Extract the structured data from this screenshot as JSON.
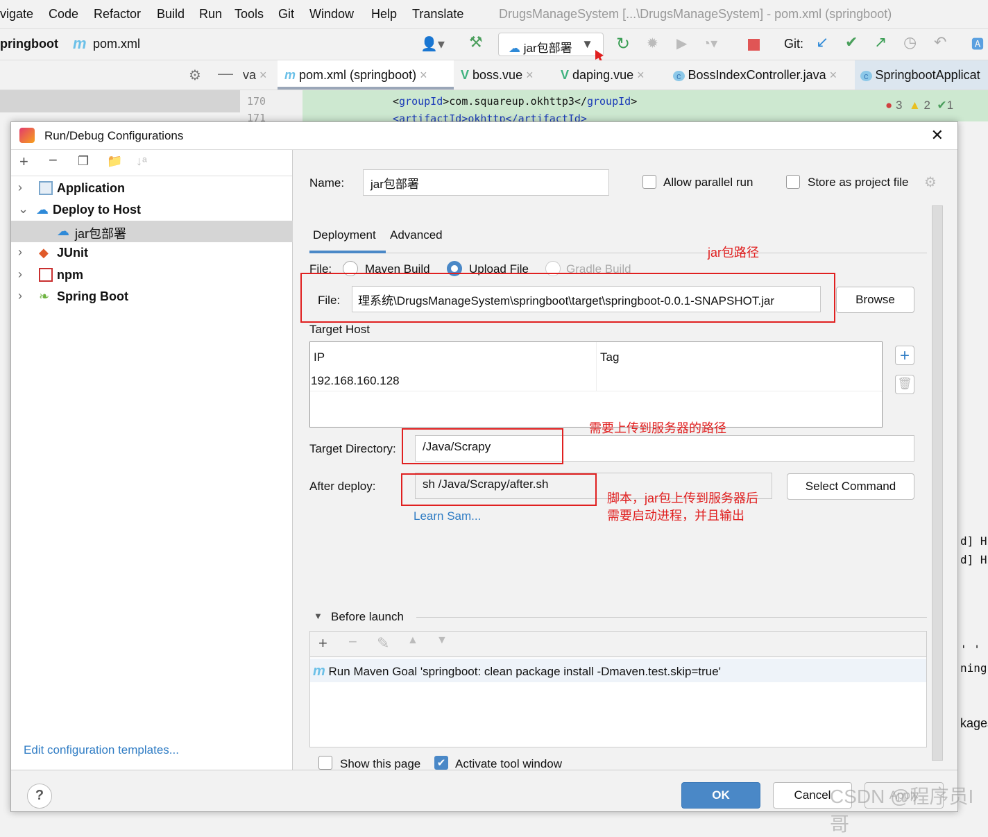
{
  "menu": [
    "vigate",
    "Code",
    "Refactor",
    "Build",
    "Run",
    "Tools",
    "Git",
    "Window",
    "Help",
    "Translate"
  ],
  "window_title": "DrugsManageSystem [...\\DrugsManageSystem] - pom.xml (springboot)",
  "breadcrumb": {
    "project": "pringboot",
    "file": "pom.xml"
  },
  "run_config": "jar包部署",
  "git_label": "Git:",
  "tabs": [
    "va",
    "pom.xml (springboot)",
    "boss.vue",
    "daping.vue",
    "BossIndexController.java",
    "SpringbootApplicat"
  ],
  "editor": {
    "line1": "170",
    "line2": "171",
    "code1_open": "<",
    "code1_tag": "groupId",
    "code1_mid": ">com.squareup.okhttp3</",
    "code1_close": ">",
    "code2": "<artifactId>okhttp</artifactId>",
    "errors": "3",
    "warnings": "2",
    "ok": "1"
  },
  "dialog": {
    "title": "Run/Debug Configurations",
    "tree": [
      {
        "label": "Application",
        "chev": "›"
      },
      {
        "label": "Deploy to Host",
        "chev": "⌄"
      },
      {
        "label": "jar包部署",
        "chev": ""
      },
      {
        "label": "JUnit",
        "chev": "›"
      },
      {
        "label": "npm",
        "chev": "›"
      },
      {
        "label": "Spring Boot",
        "chev": "›"
      }
    ],
    "edit_templates": "Edit configuration templates...",
    "name_label": "Name:",
    "name_value": "jar包部署",
    "allow_parallel": "Allow parallel run",
    "store_project": "Store as project file",
    "tab_deployment": "Deployment",
    "tab_advanced": "Advanced",
    "file_label": "File:",
    "radio_maven": "Maven Build",
    "radio_upload": "Upload File",
    "radio_gradle": "Gradle Build",
    "file_field_label": "File:",
    "file_value": "理系统\\DrugsManageSystem\\springboot\\target\\springboot-0.0.1-SNAPSHOT.jar",
    "browse": "Browse",
    "target_host": "Target Host",
    "col_ip": "IP",
    "col_tag": "Tag",
    "ip_value": "192.168.160.128",
    "target_dir_label": "Target Directory:",
    "target_dir_value": "/Java/Scrapy",
    "after_deploy_label": "After deploy:",
    "after_deploy_value": "sh /Java/Scrapy/after.sh",
    "select_command": "Select Command",
    "learn": "Learn Sam...",
    "before_launch": "Before launch",
    "maven_goal": "Run Maven Goal 'springboot: clean package install -Dmaven.test.skip=true'",
    "show_page": "Show this page",
    "activate_tool": "Activate tool window",
    "ok": "OK",
    "cancel": "Cancel",
    "apply": "Apply"
  },
  "annotations": {
    "jar_path": "jar包路径",
    "server_path": "需要上传到服务器的路径",
    "script1": "脚本，jar包上传到服务器后",
    "script2": "需要启动进程，并且输出"
  },
  "side_fragments": {
    "right": [
      "d] H",
      "d] H",
      "' '",
      "ning",
      "kages"
    ]
  },
  "watermark": "CSDN @程序员I哥",
  "colors": {
    "accent": "#4a88c7",
    "annotation": "#e02020",
    "ok_button": "#4a88c7"
  }
}
